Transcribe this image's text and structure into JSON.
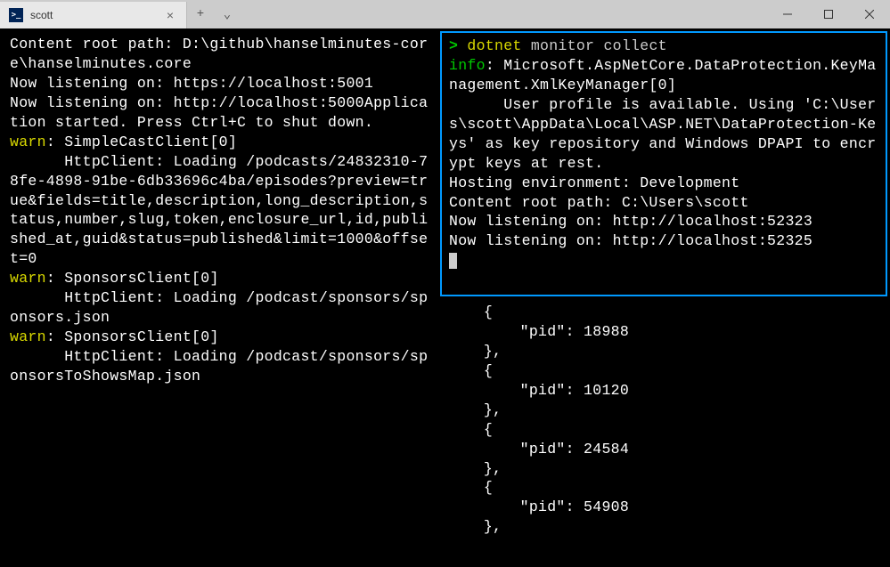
{
  "window": {
    "tab_title": "scott",
    "tab_close": "×",
    "new_tab": "+",
    "dropdown": "⌄",
    "minimize": "—",
    "maximize": "☐",
    "close": "✕"
  },
  "left_pane": {
    "l1": "Content root path: D:\\github\\hanselminutes-core\\hanselminutes.core",
    "l2": "Now listening on: https://localhost:5001",
    "l3": "",
    "l4": "Now listening on: http://localhost:5000Application started. Press Ctrl+C to shut down.",
    "warn1_prefix": "warn",
    "warn1_rest": ": SimpleCastClient[0]",
    "warn1_body": "      HttpClient: Loading /podcasts/24832310-78fe-4898-91be-6db33696c4ba/episodes?preview=true&fields=title,description,long_description,status,number,slug,token,enclosure_url,id,published_at,guid&status=published&limit=1000&offset=0",
    "warn2_prefix": "warn",
    "warn2_rest": ": SponsorsClient[0]",
    "warn2_body": "      HttpClient: Loading /podcast/sponsors/sponsors.json",
    "warn3_prefix": "warn",
    "warn3_rest": ": SponsorsClient[0]",
    "warn3_body": "      HttpClient: Loading /podcast/sponsors/sponsorsToShowsMap.json"
  },
  "right_top": {
    "prompt": ">",
    "cmd_name": "dotnet",
    "cmd_args": " monitor collect",
    "info_prefix": "info",
    "info_rest": ": Microsoft.AspNetCore.DataProtection.KeyManagement.XmlKeyManager[0]",
    "info_body": "      User profile is available. Using 'C:\\Users\\scott\\AppData\\Local\\ASP.NET\\DataProtection-Keys' as key repository and Windows DPAPI to encrypt keys at rest.",
    "host_env": "Hosting environment: Development",
    "root": "Content root path: C:\\Users\\scott",
    "listen1": "Now listening on: http://localhost:52323",
    "listen2": "Now listening on: http://localhost:52325"
  },
  "right_bottom": {
    "indent": "    ",
    "indent2": "        ",
    "open": "{",
    "close_comma": "},",
    "pids": [
      "18988",
      "10120",
      "24584",
      "54908"
    ],
    "pid_key": "\"pid\": "
  }
}
